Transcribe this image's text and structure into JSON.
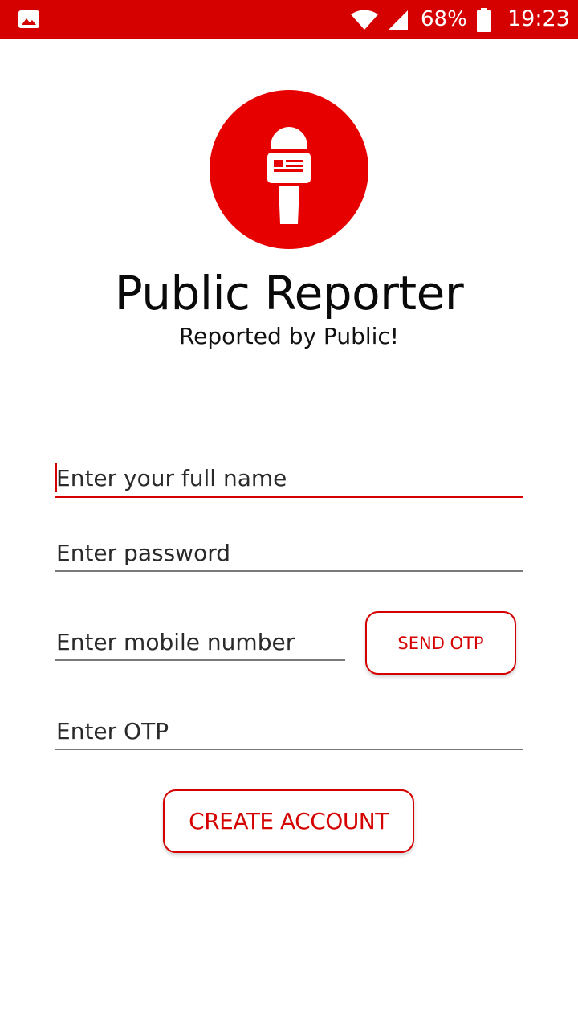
{
  "status_bar": {
    "battery_percent": "68%",
    "time": "19:23",
    "icons": [
      "gallery-icon",
      "wifi-icon",
      "signal-icon",
      "battery-icon"
    ],
    "background_color": "#d50000"
  },
  "app": {
    "logo_icon": "microphone-icon",
    "title": "Public Reporter",
    "subtitle": "Reported by Public!",
    "accent_color": "#e60000"
  },
  "form": {
    "full_name": {
      "placeholder": "Enter your full name",
      "value": ""
    },
    "password": {
      "placeholder": "Enter password",
      "value": ""
    },
    "mobile": {
      "placeholder": "Enter mobile number",
      "value": ""
    },
    "otp": {
      "placeholder": "Enter OTP",
      "value": ""
    },
    "send_otp_label": "SEND OTP",
    "create_account_label": "CREATE ACCOUNT"
  }
}
